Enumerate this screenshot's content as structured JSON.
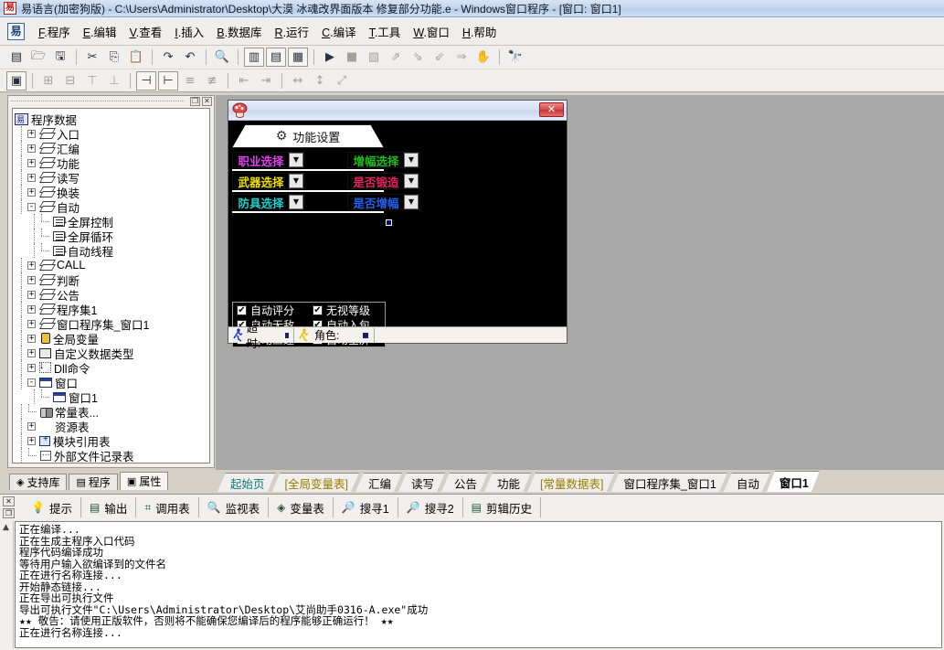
{
  "window": {
    "title": "易语言(加密狗版) - C:\\Users\\Administrator\\Desktop\\大漠 冰魂改界面版本 修复部分功能.e - Windows窗口程序 - [窗口: 窗口1]",
    "app_icon": "yi-logo-icon"
  },
  "menubar": {
    "items": [
      {
        "mnemonic": "F",
        "label": ".程序"
      },
      {
        "mnemonic": "E",
        "label": ".编辑"
      },
      {
        "mnemonic": "V",
        "label": ".查看"
      },
      {
        "mnemonic": "I",
        "label": ".插入"
      },
      {
        "mnemonic": "B",
        "label": ".数据库"
      },
      {
        "mnemonic": "R",
        "label": ".运行"
      },
      {
        "mnemonic": "C",
        "label": ".编译"
      },
      {
        "mnemonic": "T",
        "label": ".工具"
      },
      {
        "mnemonic": "W",
        "label": ".窗口"
      },
      {
        "mnemonic": "H",
        "label": ".帮助"
      }
    ]
  },
  "toolbar1": {
    "buttons": [
      {
        "name": "new-file-icon",
        "glyph": "▤",
        "state": "enabled"
      },
      {
        "name": "open-file-icon",
        "glyph": "🗁",
        "state": "enabled"
      },
      {
        "name": "save-icon",
        "glyph": "🖫",
        "state": "enabled"
      },
      {
        "name": "cut-icon",
        "glyph": "✂",
        "state": "enabled"
      },
      {
        "name": "copy-icon",
        "glyph": "⎘",
        "state": "enabled"
      },
      {
        "name": "paste-icon",
        "glyph": "📋",
        "state": "enabled"
      },
      {
        "name": "redo-icon",
        "glyph": "↷",
        "state": "enabled"
      },
      {
        "name": "undo-icon",
        "glyph": "↶",
        "state": "enabled"
      },
      {
        "name": "find-icon",
        "glyph": "🔍",
        "state": "enabled"
      },
      {
        "name": "layout-vertical-icon",
        "glyph": "▥",
        "state": "enabled"
      },
      {
        "name": "layout-horizontal-icon",
        "glyph": "▤",
        "state": "enabled"
      },
      {
        "name": "layout-grid-icon",
        "glyph": "▦",
        "state": "enabled"
      },
      {
        "name": "run-icon",
        "glyph": "▶",
        "state": "enabled"
      },
      {
        "name": "stop-icon",
        "glyph": "■",
        "state": "disabled"
      },
      {
        "name": "debug-icon",
        "glyph": "▧",
        "state": "disabled"
      },
      {
        "name": "step-over-icon",
        "glyph": "⇗",
        "state": "disabled"
      },
      {
        "name": "step-into-icon",
        "glyph": "⇘",
        "state": "disabled"
      },
      {
        "name": "step-out-icon",
        "glyph": "⇙",
        "state": "disabled"
      },
      {
        "name": "run-to-cursor-icon",
        "glyph": "⇒",
        "state": "disabled"
      },
      {
        "name": "pause-hand-icon",
        "glyph": "✋",
        "state": "disabled"
      },
      {
        "name": "search-binoculars-icon",
        "glyph": "🔭",
        "state": "enabled"
      }
    ]
  },
  "toolbar2": {
    "buttons": [
      {
        "name": "form-designer-icon",
        "glyph": "▣",
        "state": "enabled"
      },
      {
        "name": "align-left-icon",
        "glyph": "⊞",
        "state": "disabled"
      },
      {
        "name": "align-right-icon",
        "glyph": "⊟",
        "state": "disabled"
      },
      {
        "name": "align-top-icon",
        "glyph": "⊤",
        "state": "disabled"
      },
      {
        "name": "align-bottom-icon",
        "glyph": "⊥",
        "state": "disabled"
      },
      {
        "name": "center-horizontal-icon",
        "glyph": "⊣",
        "state": "enabled"
      },
      {
        "name": "center-vertical-icon",
        "glyph": "⊢",
        "state": "enabled"
      },
      {
        "name": "same-width-icon",
        "glyph": "≡",
        "state": "disabled"
      },
      {
        "name": "same-height-icon",
        "glyph": "≢",
        "state": "disabled"
      },
      {
        "name": "space-horizontal-icon",
        "glyph": "⇤",
        "state": "disabled"
      },
      {
        "name": "space-vertical-icon",
        "glyph": "⇥",
        "state": "disabled"
      },
      {
        "name": "size-width-icon",
        "glyph": "↔",
        "state": "disabled"
      },
      {
        "name": "size-height-icon",
        "glyph": "↕",
        "state": "disabled"
      },
      {
        "name": "size-both-icon",
        "glyph": "⤢",
        "state": "disabled"
      }
    ]
  },
  "panel_header": {
    "restore_glyph": "❐",
    "close_glyph": "✕"
  },
  "tree": {
    "nodes": [
      {
        "indent": 0,
        "expander": "",
        "icon": "program-data-icon",
        "icon_class": "ic-root",
        "label": "程序数据"
      },
      {
        "indent": 1,
        "expander": "+",
        "icon": "stack-icon",
        "icon_class": "ic-stack",
        "label": "入口"
      },
      {
        "indent": 1,
        "expander": "+",
        "icon": "stack-icon",
        "icon_class": "ic-stack",
        "label": "汇编"
      },
      {
        "indent": 1,
        "expander": "+",
        "icon": "stack-icon",
        "icon_class": "ic-stack",
        "label": "功能"
      },
      {
        "indent": 1,
        "expander": "+",
        "icon": "stack-icon",
        "icon_class": "ic-stack",
        "label": "读写"
      },
      {
        "indent": 1,
        "expander": "+",
        "icon": "stack-icon",
        "icon_class": "ic-stack",
        "label": "换装"
      },
      {
        "indent": 1,
        "expander": "-",
        "icon": "stack-icon",
        "icon_class": "ic-stack",
        "label": "自动"
      },
      {
        "indent": 2,
        "expander": "",
        "icon": "subroutine-icon",
        "icon_class": "ic-sub",
        "label": "全屏控制"
      },
      {
        "indent": 2,
        "expander": "",
        "icon": "subroutine-icon",
        "icon_class": "ic-sub",
        "label": "全屏循环"
      },
      {
        "indent": 2,
        "expander": "",
        "icon": "subroutine-icon",
        "icon_class": "ic-sub",
        "label": "自动线程"
      },
      {
        "indent": 1,
        "expander": "+",
        "icon": "stack-icon",
        "icon_class": "ic-stack",
        "label": "CALL"
      },
      {
        "indent": 1,
        "expander": "+",
        "icon": "stack-icon",
        "icon_class": "ic-stack",
        "label": "判断"
      },
      {
        "indent": 1,
        "expander": "+",
        "icon": "stack-icon",
        "icon_class": "ic-stack",
        "label": "公告"
      },
      {
        "indent": 1,
        "expander": "+",
        "icon": "stack-icon",
        "icon_class": "ic-stack",
        "label": "程序集1"
      },
      {
        "indent": 1,
        "expander": "+",
        "icon": "stack-icon",
        "icon_class": "ic-stack",
        "label": "窗口程序集_窗口1"
      },
      {
        "indent": 1,
        "expander": "+",
        "icon": "global-variable-icon",
        "icon_class": "ic-var",
        "label": "全局变量"
      },
      {
        "indent": 1,
        "expander": "+",
        "icon": "custom-datatype-icon",
        "icon_class": "ic-type",
        "label": "自定义数据类型"
      },
      {
        "indent": 1,
        "expander": "+",
        "icon": "dll-command-icon",
        "icon_class": "ic-dll",
        "label": "Dll命令"
      },
      {
        "indent": 1,
        "expander": "-",
        "icon": "window-folder-icon",
        "icon_class": "ic-win",
        "label": "窗口"
      },
      {
        "indent": 2,
        "expander": "",
        "icon": "window-icon",
        "icon_class": "ic-win",
        "label": "窗口1"
      },
      {
        "indent": 1,
        "expander": "",
        "icon": "constant-table-icon",
        "icon_class": "ic-const",
        "label": "常量表..."
      },
      {
        "indent": 1,
        "expander": "+",
        "icon": "resource-table-icon",
        "icon_class": "ic-res",
        "label": "资源表"
      },
      {
        "indent": 1,
        "expander": "+",
        "icon": "module-reference-icon",
        "icon_class": "ic-mod",
        "label": "模块引用表"
      },
      {
        "indent": 1,
        "expander": "",
        "icon": "external-file-icon",
        "icon_class": "ic-ext",
        "label": "外部文件记录表"
      }
    ]
  },
  "left_tabs": {
    "items": [
      {
        "label": "支持库",
        "icon": "stack-icon",
        "glyph": "◈",
        "active": false
      },
      {
        "label": "程序",
        "icon": "program-icon",
        "glyph": "▤",
        "active": false
      },
      {
        "label": "属性",
        "icon": "properties-icon",
        "glyph": "▣",
        "active": true
      }
    ]
  },
  "form": {
    "title": "",
    "icon": "mushroom-icon",
    "close_label": "✕",
    "group_header": {
      "label": "功能设置",
      "icon": "gear-icon",
      "glyph": "⚙"
    },
    "combos": [
      {
        "label": "职业选择",
        "color": "#e040f0",
        "arrow": "▼"
      },
      {
        "label": "增幅选择",
        "color": "#18c018",
        "arrow": "▼"
      },
      {
        "label": "武器选择",
        "color": "#f0e000",
        "arrow": "▼"
      },
      {
        "label": "是否锻造",
        "color": "#e82060",
        "arrow": "▼"
      },
      {
        "label": "防具选择",
        "color": "#20d0d0",
        "arrow": "▼"
      },
      {
        "label": "是否增幅",
        "color": "#2060f0",
        "arrow": "▼"
      }
    ],
    "checkboxes": [
      {
        "label": "自动评分",
        "checked": true
      },
      {
        "label": "无视等级",
        "checked": true
      },
      {
        "label": "自动无敌",
        "checked": true
      },
      {
        "label": "自动入包",
        "checked": true
      },
      {
        "label": "自动三速",
        "checked": true
      },
      {
        "label": "自动全屏",
        "checked": false
      }
    ],
    "statusbar": [
      {
        "icon": "runner-icon",
        "glyph": "🏃",
        "label": "超时:",
        "value": ""
      },
      {
        "icon": "character-icon",
        "glyph": "🏃",
        "label": "角色:",
        "value": ""
      }
    ]
  },
  "doc_tabs": {
    "items": [
      {
        "label": "起始页",
        "color": "#0f7a7a",
        "active": false,
        "bold": false
      },
      {
        "label": "[全局变量表]",
        "color": "#9a7b00",
        "active": false,
        "bold": false
      },
      {
        "label": "汇编",
        "color": "#000000",
        "active": false,
        "bold": false
      },
      {
        "label": "读写",
        "color": "#000000",
        "active": false,
        "bold": false
      },
      {
        "label": "公告",
        "color": "#000000",
        "active": false,
        "bold": false
      },
      {
        "label": "功能",
        "color": "#000000",
        "active": false,
        "bold": false
      },
      {
        "label": "[常量数据表]",
        "color": "#9a7b00",
        "active": false,
        "bold": false
      },
      {
        "label": "窗口程序集_窗口1",
        "color": "#000000",
        "active": false,
        "bold": false
      },
      {
        "label": "自动",
        "color": "#000000",
        "active": false,
        "bold": false
      },
      {
        "label": "窗口1",
        "color": "#000000",
        "active": true,
        "bold": true
      }
    ]
  },
  "bottom_tabs": {
    "close_glyph": "✕",
    "restore_glyph": "❐",
    "items": [
      {
        "label": "提示",
        "icon": "lightbulb-icon",
        "glyph": "💡",
        "active": false
      },
      {
        "label": "输出",
        "icon": "output-icon",
        "glyph": "▤",
        "active": true
      },
      {
        "label": "调用表",
        "icon": "call-table-icon",
        "glyph": "⌗",
        "active": false
      },
      {
        "label": "监视表",
        "icon": "watch-icon",
        "glyph": "🔍",
        "active": false
      },
      {
        "label": "变量表",
        "icon": "variable-table-icon",
        "glyph": "◈",
        "active": false
      },
      {
        "label": "搜寻1",
        "icon": "search-icon",
        "glyph": "🔎",
        "active": false
      },
      {
        "label": "搜寻2",
        "icon": "search-icon",
        "glyph": "🔎",
        "active": false
      },
      {
        "label": "剪辑历史",
        "icon": "clip-history-icon",
        "glyph": "▤",
        "active": false
      }
    ]
  },
  "output": {
    "lines": [
      "正在编译...",
      "正在生成主程序入口代码",
      "程序代码编译成功",
      "等待用户输入欲编译到的文件名",
      "正在进行名称连接...",
      "开始静态链接...",
      "正在导出可执行文件",
      "导出可执行文件\"C:\\Users\\Administrator\\Desktop\\艾尚助手0316-A.exe\"成功",
      "★★ 敬告：请使用正版软件，否则将不能确保您编译后的程序能够正确运行！ ★★",
      "正在进行名称连接..."
    ]
  }
}
